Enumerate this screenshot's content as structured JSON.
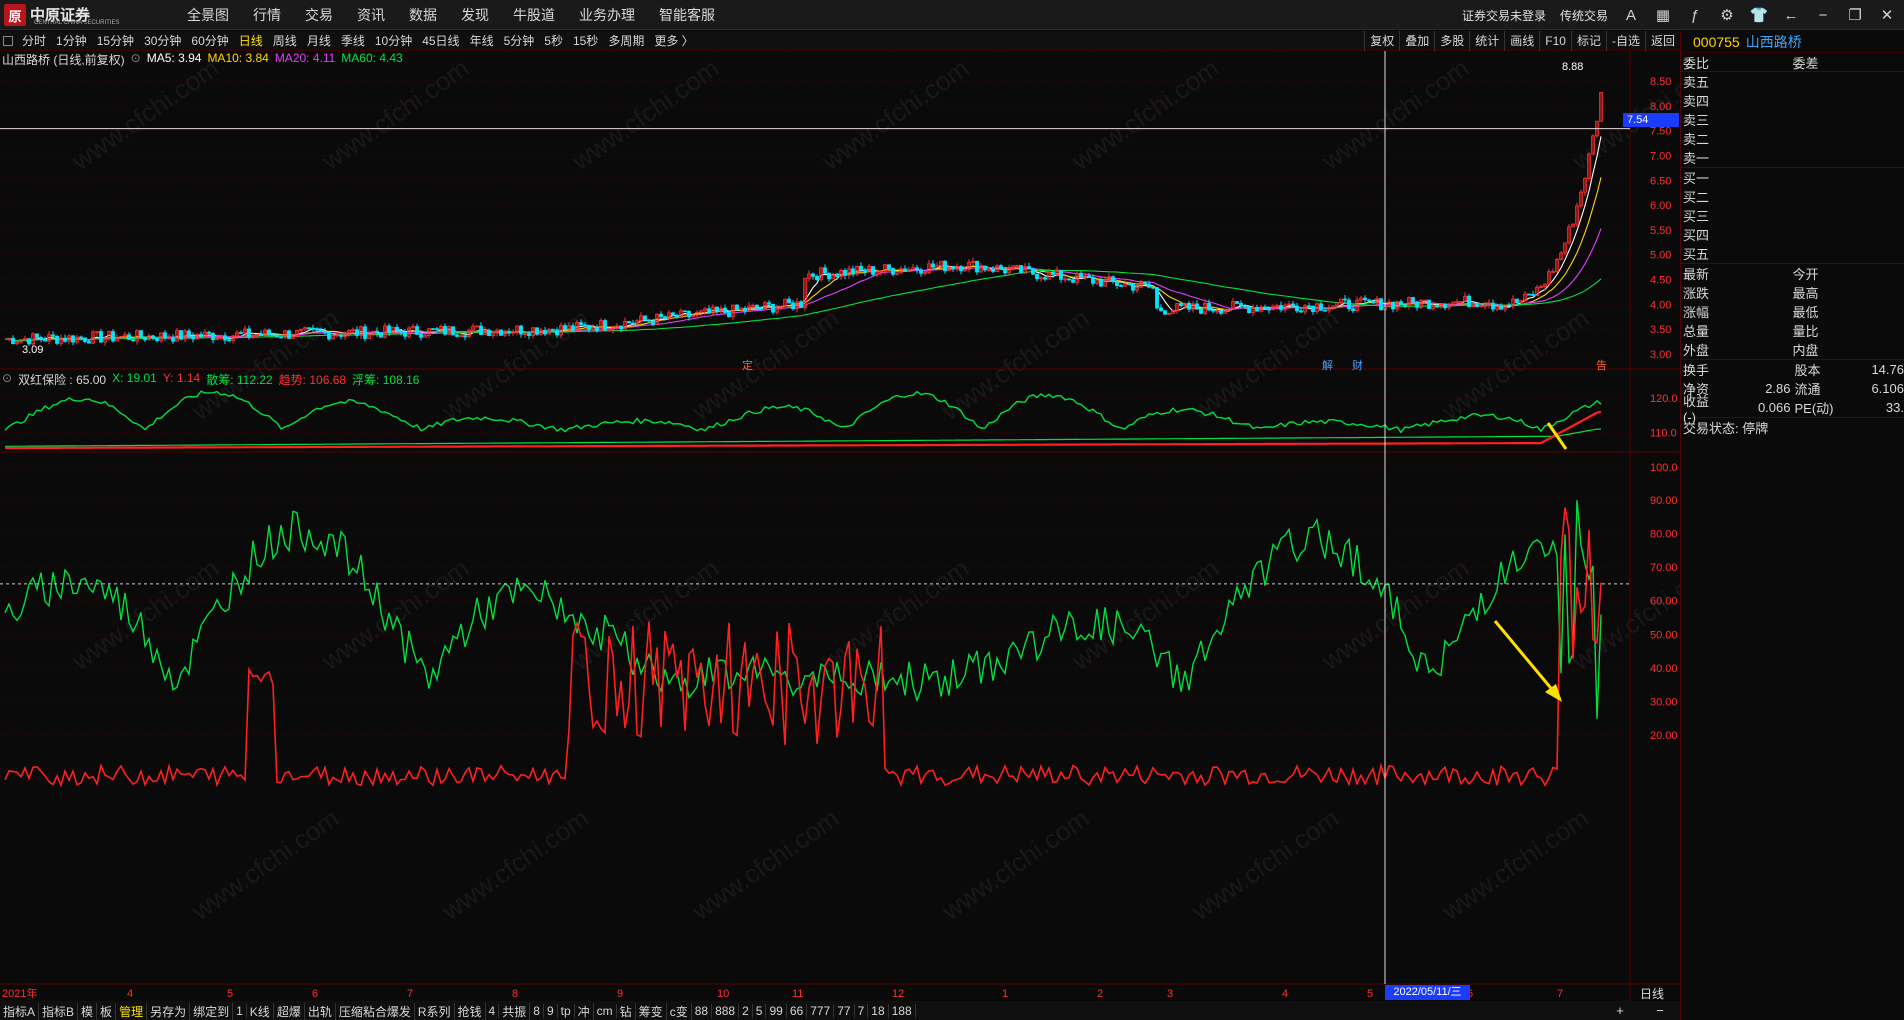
{
  "brand": {
    "logo_text": "中原证券",
    "logo_sub": "CENTRAL CHINA SECURITIES",
    "logo_mark": "原"
  },
  "nav": [
    "全景图",
    "行情",
    "交易",
    "资讯",
    "数据",
    "发现",
    "牛股道",
    "业务办理",
    "智能客服"
  ],
  "top_right": {
    "login": "证券交易未登录",
    "trade": "传统交易"
  },
  "periods": [
    "分时",
    "1分钟",
    "15分钟",
    "30分钟",
    "60分钟",
    "日线",
    "周线",
    "月线",
    "季线",
    "10分钟",
    "45日线",
    "年线",
    "5分钟",
    "5秒",
    "15秒",
    "多周期",
    "更多 〉"
  ],
  "selected_period": "日线",
  "tool_buttons": [
    "复权",
    "叠加",
    "多股",
    "统计",
    "画线",
    "F10",
    "标记",
    "-自选",
    "返回"
  ],
  "main_chart": {
    "title": "山西路桥 (日线,前复权)",
    "ma5": "MA5: 3.94",
    "ma10": "MA10: 3.84",
    "ma20": "MA20: 4.11",
    "ma60": "MA60: 4.43",
    "price_axis": [
      "8.50",
      "8.00",
      "7.50",
      "7.00",
      "6.50",
      "6.00",
      "5.50",
      "5.00",
      "4.50",
      "4.00",
      "3.50",
      "3.00"
    ],
    "crosshair_price": "7.54",
    "high_label": "8.88",
    "low_label": "3.09",
    "markers": {
      "ding": "定",
      "jie": "解",
      "cai": "财",
      "gaobei": "告"
    },
    "colors": {
      "up": "#ff3030",
      "down": "#00e5ff",
      "ma5": "#ffffff",
      "ma10": "#ffd700",
      "ma20": "#e040fb",
      "ma60": "#00e040"
    }
  },
  "indicator1": {
    "title": "双红保险 : 65.00",
    "x": "X: 19.01",
    "y": "Y: 1.14",
    "sanchou": "散筹: 112.22",
    "qushi": "趋势: 106.68",
    "fuchou": "浮筹: 108.16",
    "axis": [
      "120.0",
      "110.0",
      "100.0"
    ]
  },
  "indicator2": {
    "axis": [
      "90.00",
      "80.00",
      "70.00",
      "60.00",
      "50.00",
      "40.00",
      "30.00",
      "20.00"
    ]
  },
  "x_axis": {
    "labels": [
      "2021年",
      "4",
      "5",
      "6",
      "7",
      "8",
      "9",
      "10",
      "11",
      "12",
      "1",
      "2",
      "3",
      "4",
      "5",
      "6",
      "7"
    ],
    "crosshair_date": "2022/05/11/三",
    "period_label": "日线"
  },
  "chart_data": {
    "type": "line",
    "series": [
      {
        "name": "MA5",
        "latest": 3.94
      },
      {
        "name": "MA10",
        "latest": 3.84
      },
      {
        "name": "MA20",
        "latest": 4.11
      },
      {
        "name": "MA60",
        "latest": 4.43
      }
    ],
    "ylim": [
      3.0,
      8.9
    ]
  },
  "bottom_tabs": [
    "指标A",
    "指标B",
    "模",
    "板",
    "管理",
    "另存为",
    "绑定到",
    "1",
    "K线",
    "超爆",
    "出轨",
    "压缩粘合爆发",
    "R系列",
    "抢钱",
    "4",
    "共振",
    "8",
    "9",
    "tp",
    "冲",
    "cm",
    "钻",
    "筹变",
    "c变",
    "88",
    "888",
    "2",
    "5",
    "99",
    "66",
    "777",
    "77",
    "7",
    "18",
    "188"
  ],
  "bottom_selected": "管理",
  "bottom_right": [
    "+",
    "−"
  ],
  "right_panel": {
    "code": "000755",
    "name": "山西路桥",
    "weibi": "委比",
    "weicha": "委差",
    "sells": [
      "卖五",
      "卖四",
      "卖三",
      "卖二",
      "卖一"
    ],
    "buys": [
      "买一",
      "买二",
      "买三",
      "买四",
      "买五"
    ],
    "quote_left": [
      "最新",
      "涨跌",
      "涨幅",
      "总量",
      "外盘"
    ],
    "quote_right": [
      "今开",
      "最高",
      "最低",
      "量比",
      "内盘"
    ],
    "stats": [
      {
        "k": "换手",
        "v": "",
        "k2": "股本",
        "v2": "14.76"
      },
      {
        "k": "净资",
        "v": "2.86",
        "k2": "流通",
        "v2": "6.106"
      },
      {
        "k": "收益(-)",
        "v": "0.066",
        "k2": "PE(动)",
        "v2": "33."
      }
    ],
    "status": "交易状态: 停牌"
  },
  "watermark": "www.cfchi.com"
}
